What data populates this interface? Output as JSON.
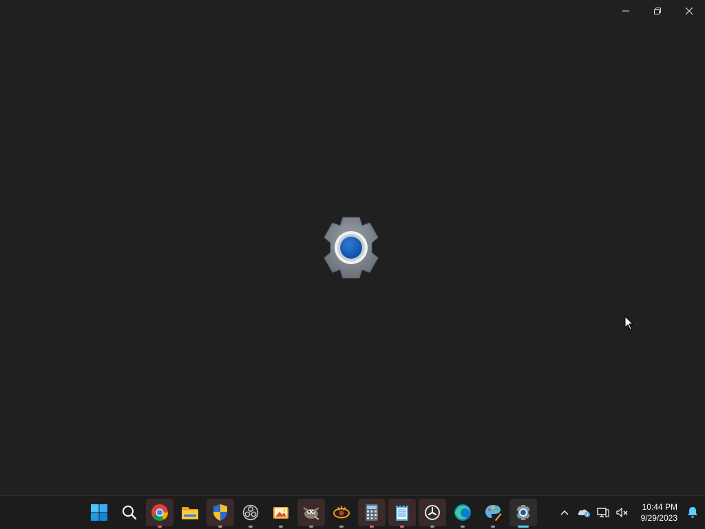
{
  "window": {
    "background": "#202020",
    "caption": {
      "minimize_icon": "minimize-icon",
      "restore_icon": "restore-icon",
      "close_icon": "close-icon"
    },
    "splash_icon": "settings-gear-icon"
  },
  "taskbar": {
    "pinned_apps": [
      {
        "icon": "windows-start-icon",
        "state": "none"
      },
      {
        "icon": "search-icon",
        "state": "none"
      },
      {
        "icon": "chrome-icon",
        "state": "open"
      },
      {
        "icon": "file-explorer-icon",
        "state": "none"
      },
      {
        "icon": "security-shield-icon",
        "state": "open"
      },
      {
        "icon": "obs-studio-icon",
        "state": "none"
      },
      {
        "icon": "photos-icon",
        "state": "none"
      },
      {
        "icon": "gimp-icon",
        "state": "open"
      },
      {
        "icon": "xnview-icon",
        "state": "none"
      },
      {
        "icon": "calculator-icon",
        "state": "open"
      },
      {
        "icon": "notepad-icon",
        "state": "open"
      },
      {
        "icon": "clock-icon",
        "state": "open"
      },
      {
        "icon": "edge-icon",
        "state": "none"
      },
      {
        "icon": "paint-icon",
        "state": "none"
      },
      {
        "icon": "settings-icon",
        "state": "active"
      }
    ],
    "tray": {
      "chevron_icon": "chevron-up-icon",
      "onedrive_icon": "cloud-info-icon",
      "network_icon": "network-icon",
      "volume_icon": "volume-muted-icon",
      "time": "10:44 PM",
      "date": "9/29/2023",
      "notification_icon": "notification-bell-icon"
    },
    "accent_color": "#60cdff"
  }
}
